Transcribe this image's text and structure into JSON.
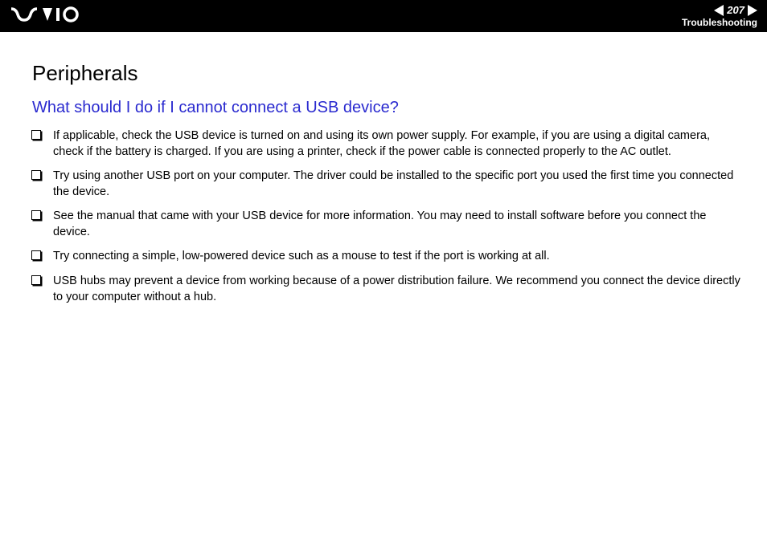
{
  "header": {
    "page_number": "207",
    "section": "Troubleshooting"
  },
  "content": {
    "title": "Peripherals",
    "subtitle": "What should I do if I cannot connect a USB device?",
    "bullets": [
      "If applicable, check the USB device is turned on and using its own power supply. For example, if you are using a digital camera, check if the battery is charged. If you are using a printer, check if the power cable is connected properly to the AC outlet.",
      "Try using another USB port on your computer. The driver could be installed to the specific port you used the first time you connected the device.",
      "See the manual that came with your USB device for more information. You may need to install software before you connect the device.",
      "Try connecting a simple, low-powered device such as a mouse to test if the port is working at all.",
      "USB hubs may prevent a device from working because of a power distribution failure. We recommend you connect the device directly to your computer without a hub."
    ]
  }
}
